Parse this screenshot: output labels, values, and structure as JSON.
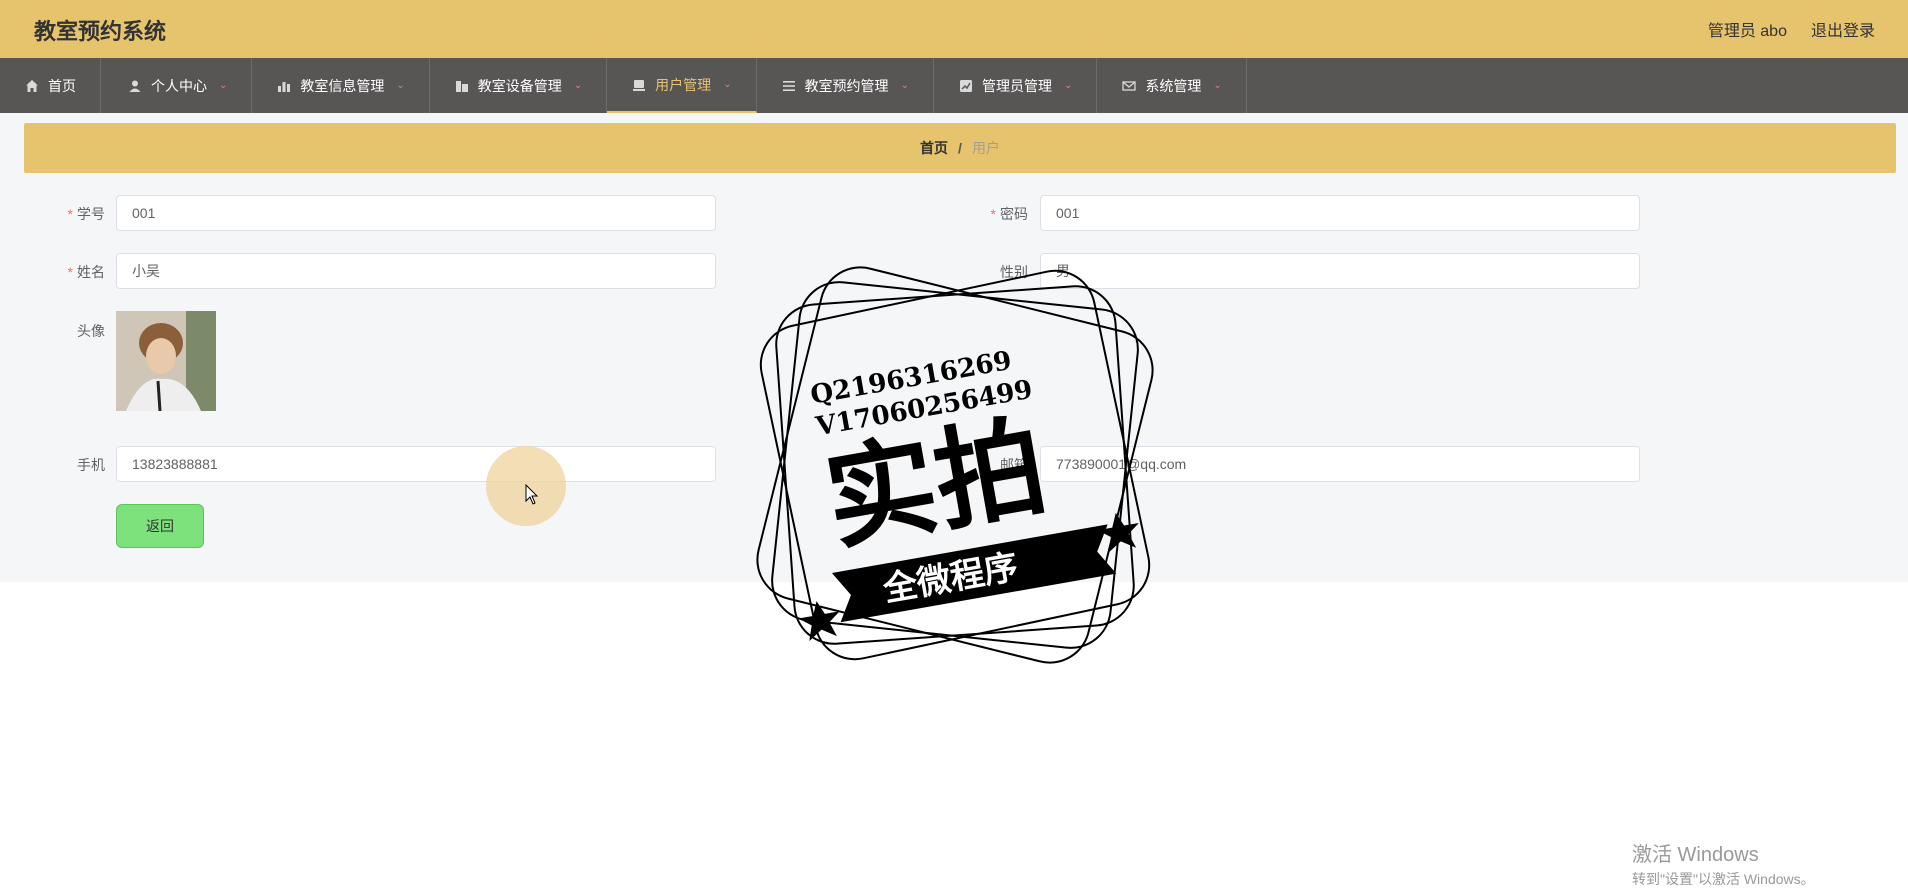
{
  "header": {
    "title": "教室预约系统",
    "user": "管理员 abo",
    "logout": "退出登录"
  },
  "nav": [
    {
      "label": "首页",
      "icon": "home-icon",
      "active": false,
      "has_menu": false
    },
    {
      "label": "个人中心",
      "icon": "person-icon",
      "active": false,
      "has_menu": true
    },
    {
      "label": "教室信息管理",
      "icon": "bar-chart-icon",
      "active": false,
      "has_menu": true
    },
    {
      "label": "教室设备管理",
      "icon": "building-icon",
      "active": false,
      "has_menu": true
    },
    {
      "label": "用户管理",
      "icon": "user-card-icon",
      "active": true,
      "has_menu": true
    },
    {
      "label": "教室预约管理",
      "icon": "list-icon",
      "active": false,
      "has_menu": true
    },
    {
      "label": "管理员管理",
      "icon": "trend-icon",
      "active": false,
      "has_menu": true
    },
    {
      "label": "系统管理",
      "icon": "mail-icon",
      "active": false,
      "has_menu": true
    }
  ],
  "breadcrumb": {
    "home": "首页",
    "separator": "/",
    "current": "用户"
  },
  "form": {
    "student_id": {
      "label": "学号",
      "value": "001",
      "required": true
    },
    "password": {
      "label": "密码",
      "value": "001",
      "required": true
    },
    "name": {
      "label": "姓名",
      "value": "小吴",
      "required": true
    },
    "gender": {
      "label": "性别",
      "value": "男",
      "required": false
    },
    "avatar": {
      "label": "头像"
    },
    "phone": {
      "label": "手机",
      "value": "13823888881"
    },
    "email": {
      "label": "邮箱",
      "value": "773890001@qq.com"
    },
    "back_button": "返回"
  },
  "watermark": {
    "line1": "Q2196316269",
    "line2": "V17060256499",
    "big": "实拍",
    "ribbon": "全微程序"
  },
  "windows_activation": {
    "line1": "激活 Windows",
    "line2": "转到\"设置\"以激活 Windows。"
  },
  "colors": {
    "header_bg": "#e6c46e",
    "nav_bg": "#585555",
    "active_nav": "#e6c46e",
    "back_button_bg": "#7ee27c"
  }
}
